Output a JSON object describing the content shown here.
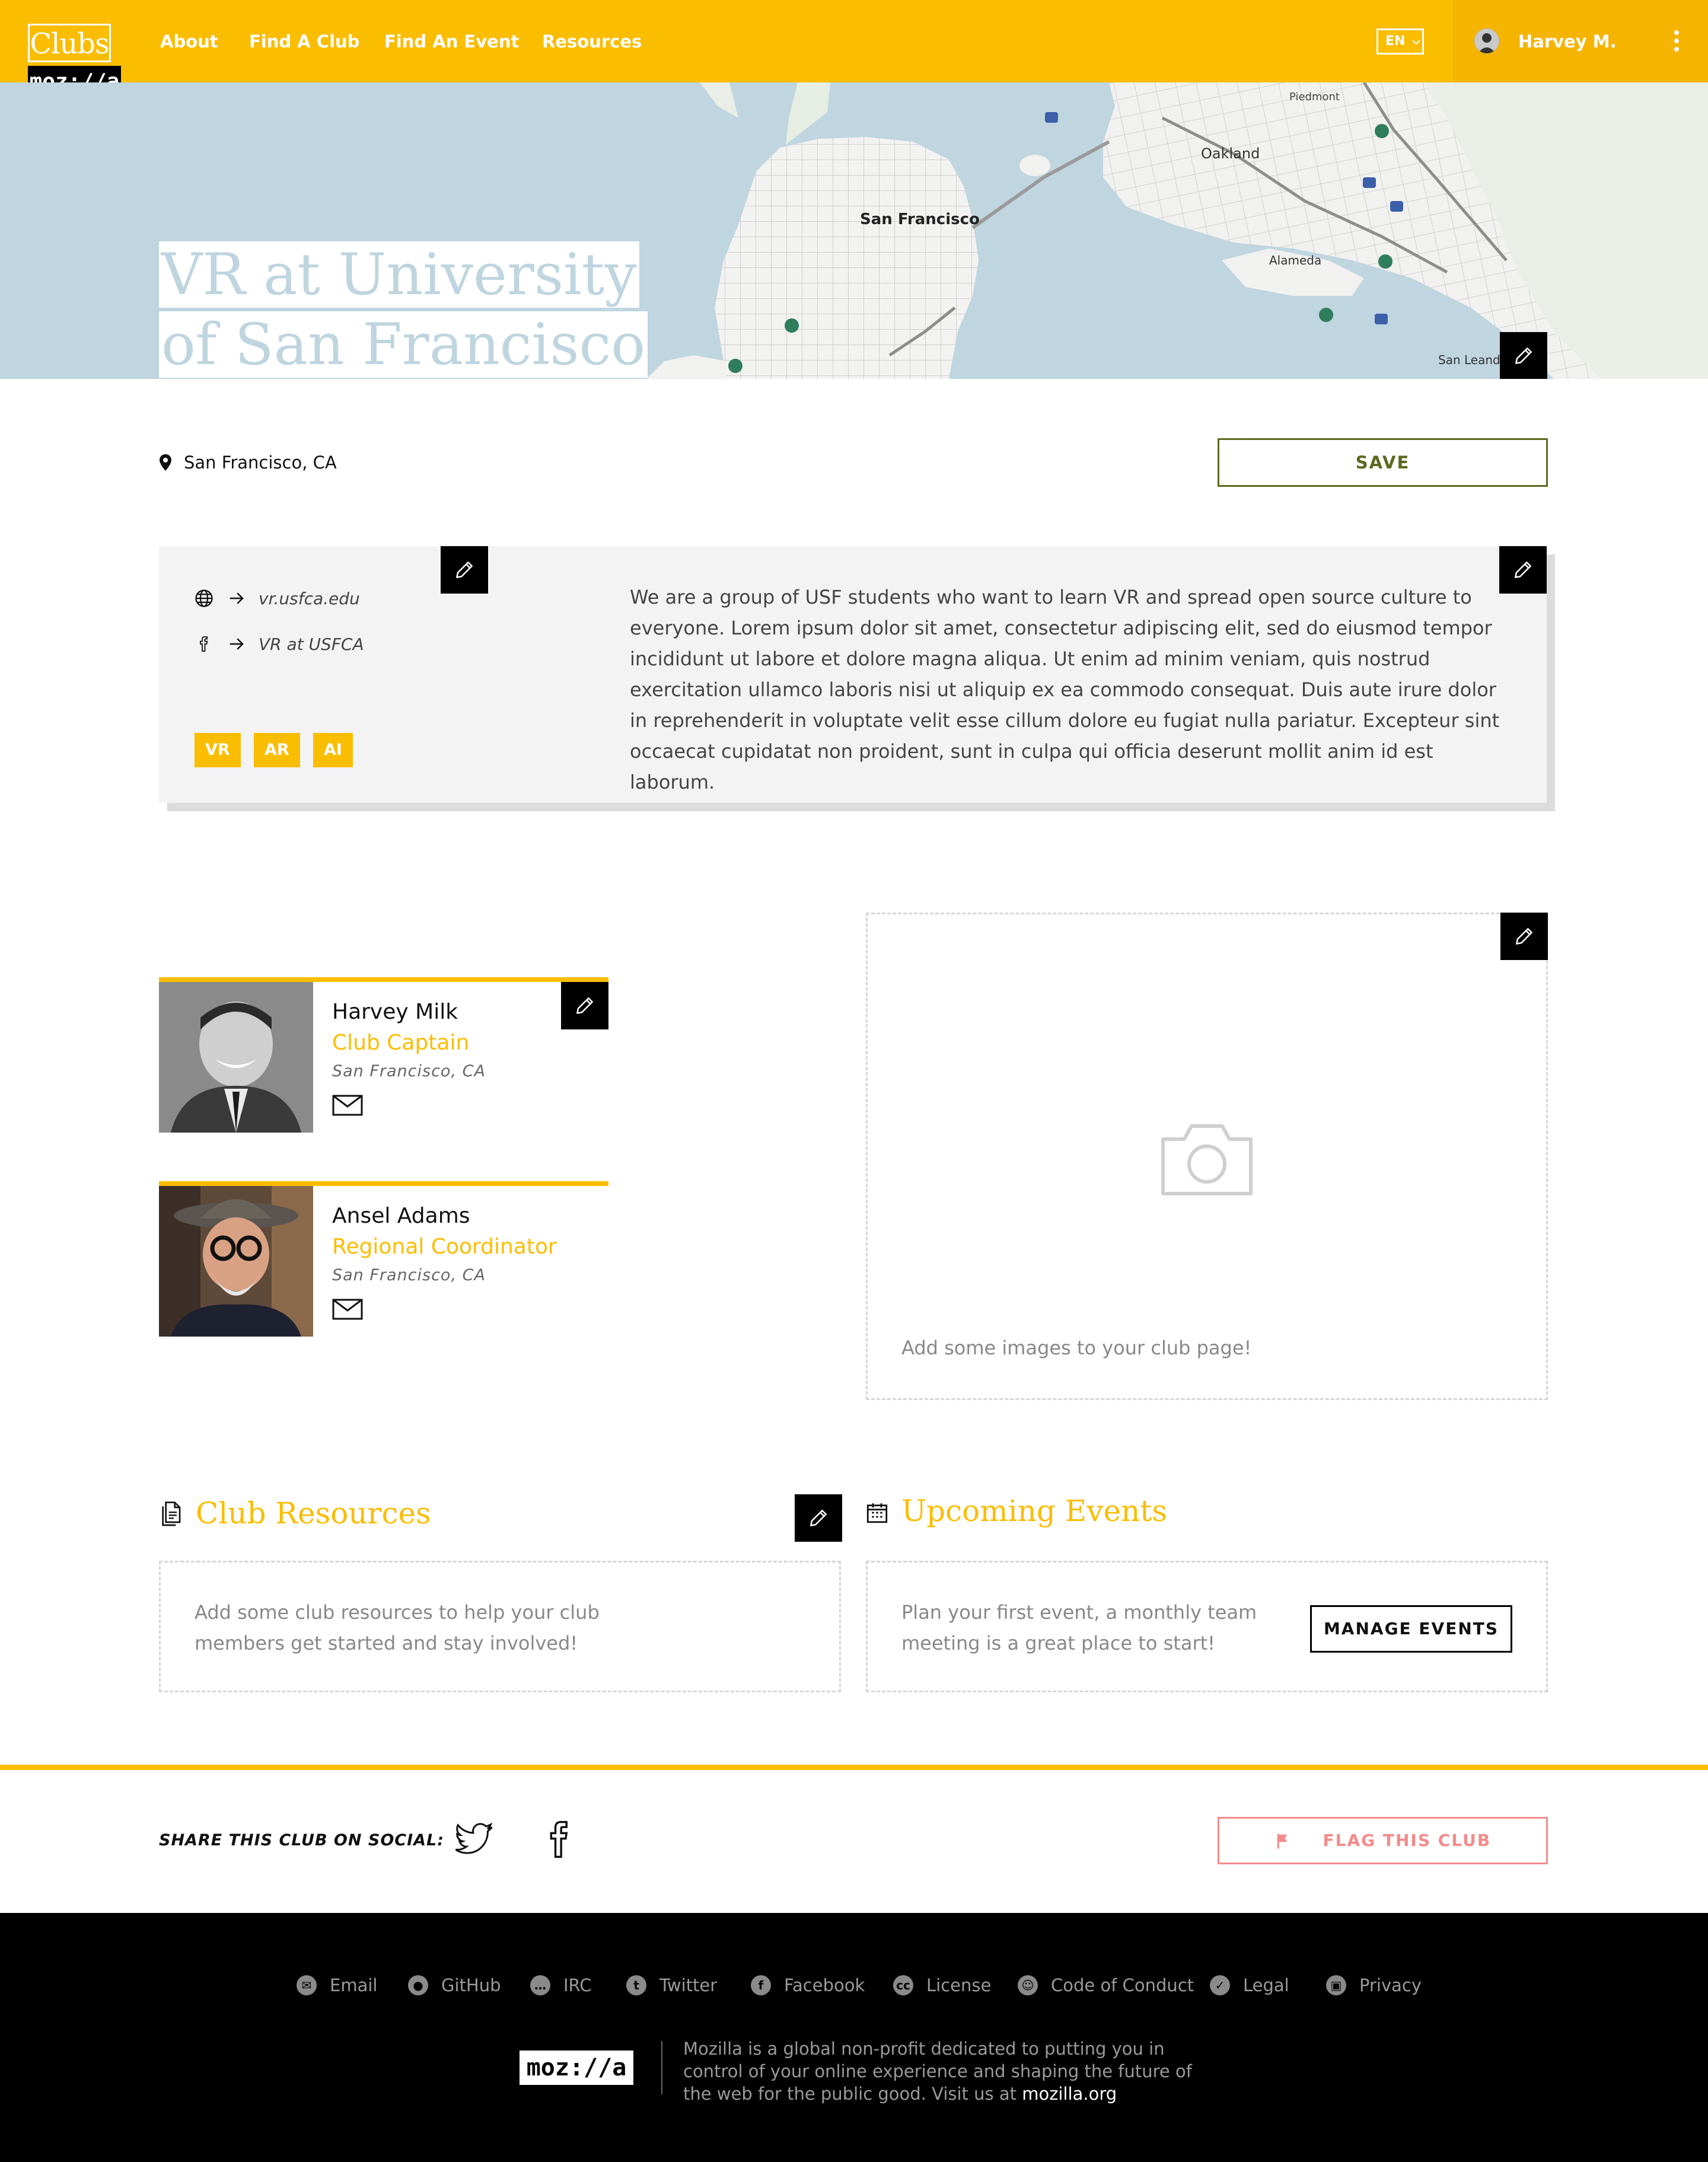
{
  "header": {
    "logo_clubs": "Clubs",
    "logo_mozilla": "moz://a",
    "nav": [
      "About",
      "Find A Club",
      "Find An Event",
      "Resources"
    ],
    "language": "EN",
    "user_name": "Harvey M."
  },
  "hero": {
    "title": "VR at University of San Francisco",
    "map_labels": [
      "San Francisco",
      "Oakland",
      "Alameda",
      "San Leandro",
      "Piedmont"
    ]
  },
  "club": {
    "location": "San Francisco, CA",
    "save_label": "SAVE",
    "website": "vr.usfca.edu",
    "facebook": "VR at USFCA",
    "tags": [
      "VR",
      "AR",
      "AI"
    ],
    "description": "We are a group of USF students who want to learn VR and spread open source culture to everyone. Lorem ipsum dolor sit amet, consectetur adipiscing elit, sed do eiusmod tempor incididunt ut labore et dolore magna aliqua. Ut enim ad minim veniam, quis nostrud exercitation ullamco laboris nisi ut aliquip ex ea commodo consequat. Duis aute irure dolor in reprehenderit in voluptate velit esse cillum dolore eu fugiat nulla pariatur. Excepteur sint occaecat cupidatat non proident, sunt in culpa qui officia deserunt mollit anim id est laborum."
  },
  "people": [
    {
      "name": "Harvey Milk",
      "role": "Club Captain",
      "location": "San Francisco, CA"
    },
    {
      "name": "Ansel Adams",
      "role": "Regional Coordinator",
      "location": "San Francisco, CA"
    }
  ],
  "images": {
    "empty_note": "Add some images to your club page!"
  },
  "resources": {
    "title": "Club Resources",
    "empty_note": "Add some club resources to help your club members get started and stay involved!"
  },
  "events": {
    "title": "Upcoming Events",
    "empty_note": "Plan your first event, a monthly team meeting is a great place to start!",
    "manage_label": "MANAGE EVENTS"
  },
  "social": {
    "share_label": "SHARE THIS CLUB ON SOCIAL:",
    "flag_label": "FLAG THIS CLUB"
  },
  "footer": {
    "links": [
      "Email",
      "GitHub",
      "IRC",
      "Twitter",
      "Facebook",
      "License",
      "Code of Conduct",
      "Legal",
      "Privacy"
    ],
    "logo": "moz://a",
    "text": "Mozilla is a global non-profit dedicated to putting you in control of your online experience and shaping the future of the web for the public good. Visit us at ",
    "site_link": "mozilla.org"
  },
  "colors": {
    "brand_yellow": "#fbbd00",
    "save_green": "#5a6b1e",
    "flag_red": "#f48b8b",
    "map_water": "#bfd5df"
  }
}
